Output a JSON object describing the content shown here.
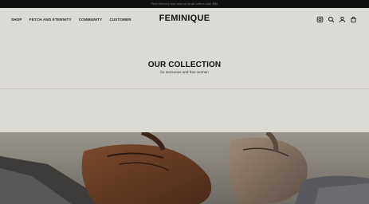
{
  "announcement": "Free delivery and returns on all orders over €80",
  "nav": {
    "items": [
      {
        "label": "SHOP"
      },
      {
        "label": "FETCH AND ETERNITY"
      },
      {
        "label": "COMMUNITY"
      },
      {
        "label": "CUSTOMER"
      }
    ]
  },
  "brand": {
    "logo": "FEMINIQUE"
  },
  "header_icons": [
    "instagram-icon",
    "search-icon",
    "account-icon",
    "bag-icon"
  ],
  "collection": {
    "title": "OUR COLLECTION",
    "subtitle": "for sensuous and free women"
  },
  "colors": {
    "background": "#dcdad5",
    "announcement_bar": "#111111",
    "text": "#111111"
  }
}
